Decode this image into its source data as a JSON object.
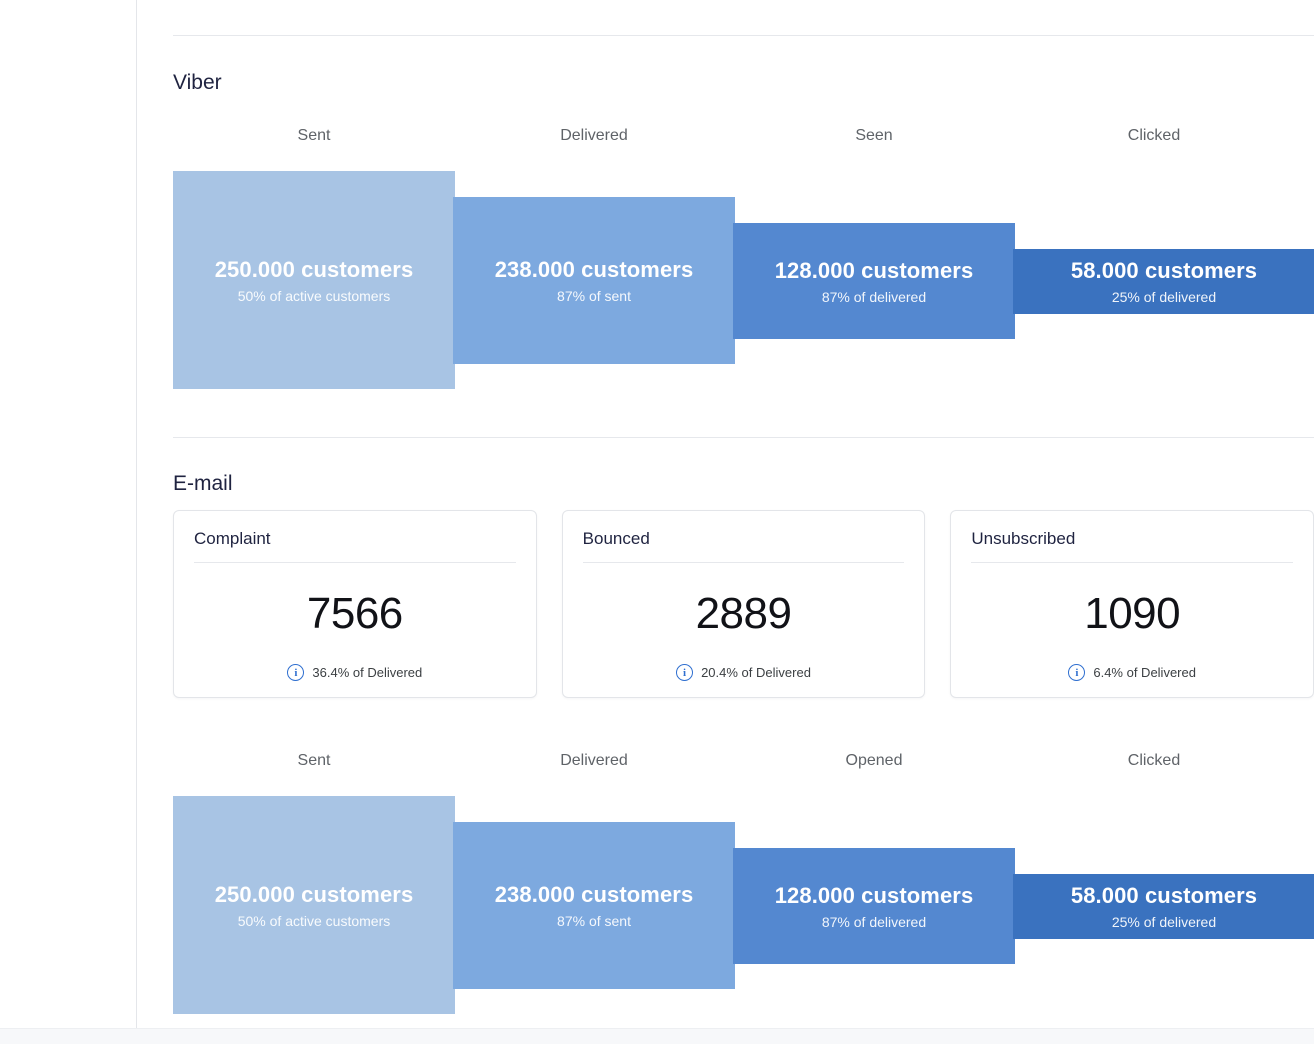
{
  "colors": {
    "bar_sent": "#a8c4e4",
    "bar_delivered": "#7da9df",
    "bar_seen": "#5488d0",
    "bar_clicked": "#3a72bf",
    "accent": "#2f6fd0",
    "text_primary": "#1f2340",
    "text_muted": "#5f6368",
    "divider": "#e6e8ec"
  },
  "sections": {
    "viber": {
      "title": "Viber",
      "funnel": {
        "headers": [
          "Sent",
          "Delivered",
          "Seen",
          "Clicked"
        ],
        "steps": [
          {
            "header": "Sent",
            "value": "250.000 customers",
            "sub": "50% of active customers",
            "color": "#a8c4e4"
          },
          {
            "header": "Delivered",
            "value": "238.000 customers",
            "sub": "87% of sent",
            "color": "#7da9df"
          },
          {
            "header": "Seen",
            "value": "128.000 customers",
            "sub": "87% of delivered",
            "color": "#5488d0"
          },
          {
            "header": "Clicked",
            "value": "58.000 customers",
            "sub": "25% of delivered",
            "color": "#3a72bf"
          }
        ]
      }
    },
    "email": {
      "title": "E-mail",
      "cards": [
        {
          "title": "Complaint",
          "value": "7566",
          "footnote": "36.4% of Delivered",
          "icon": "info-icon"
        },
        {
          "title": "Bounced",
          "value": "2889",
          "footnote": "20.4% of Delivered",
          "icon": "info-icon"
        },
        {
          "title": "Unsubscribed",
          "value": "1090",
          "footnote": "6.4% of Delivered",
          "icon": "info-icon"
        }
      ],
      "funnel": {
        "headers": [
          "Sent",
          "Delivered",
          "Opened",
          "Clicked"
        ],
        "steps": [
          {
            "header": "Sent",
            "value": "250.000 customers",
            "sub": "50% of active customers",
            "color": "#a8c4e4"
          },
          {
            "header": "Delivered",
            "value": "238.000 customers",
            "sub": "87% of sent",
            "color": "#7da9df"
          },
          {
            "header": "Opened",
            "value": "128.000 customers",
            "sub": "87% of delivered",
            "color": "#5488d0"
          },
          {
            "header": "Clicked",
            "value": "58.000 customers",
            "sub": "25% of delivered",
            "color": "#3a72bf"
          }
        ]
      }
    }
  },
  "chart_data": [
    {
      "type": "bar",
      "title": "Viber",
      "categories": [
        "Sent",
        "Delivered",
        "Seen",
        "Clicked"
      ],
      "values": [
        250000,
        238000,
        128000,
        58000
      ],
      "value_labels": [
        "250.000 customers",
        "238.000 customers",
        "128.000 customers",
        "58.000 customers"
      ],
      "rate_labels": [
        "50% of active customers",
        "87% of sent",
        "87% of delivered",
        "25% of delivered"
      ],
      "rates": [
        50,
        87,
        87,
        25
      ],
      "colors": [
        "#a8c4e4",
        "#7da9df",
        "#5488d0",
        "#3a72bf"
      ],
      "xlabel": "",
      "ylabel": "",
      "grid": false,
      "legend": "none"
    },
    {
      "type": "bar",
      "title": "E-mail",
      "categories": [
        "Sent",
        "Delivered",
        "Opened",
        "Clicked"
      ],
      "values": [
        250000,
        238000,
        128000,
        58000
      ],
      "value_labels": [
        "250.000 customers",
        "238.000 customers",
        "128.000 customers",
        "58.000 customers"
      ],
      "rate_labels": [
        "50% of active customers",
        "87% of sent",
        "87% of delivered",
        "25% of delivered"
      ],
      "rates": [
        50,
        87,
        87,
        25
      ],
      "colors": [
        "#a8c4e4",
        "#7da9df",
        "#5488d0",
        "#3a72bf"
      ],
      "xlabel": "",
      "ylabel": "",
      "grid": false,
      "legend": "none"
    }
  ]
}
